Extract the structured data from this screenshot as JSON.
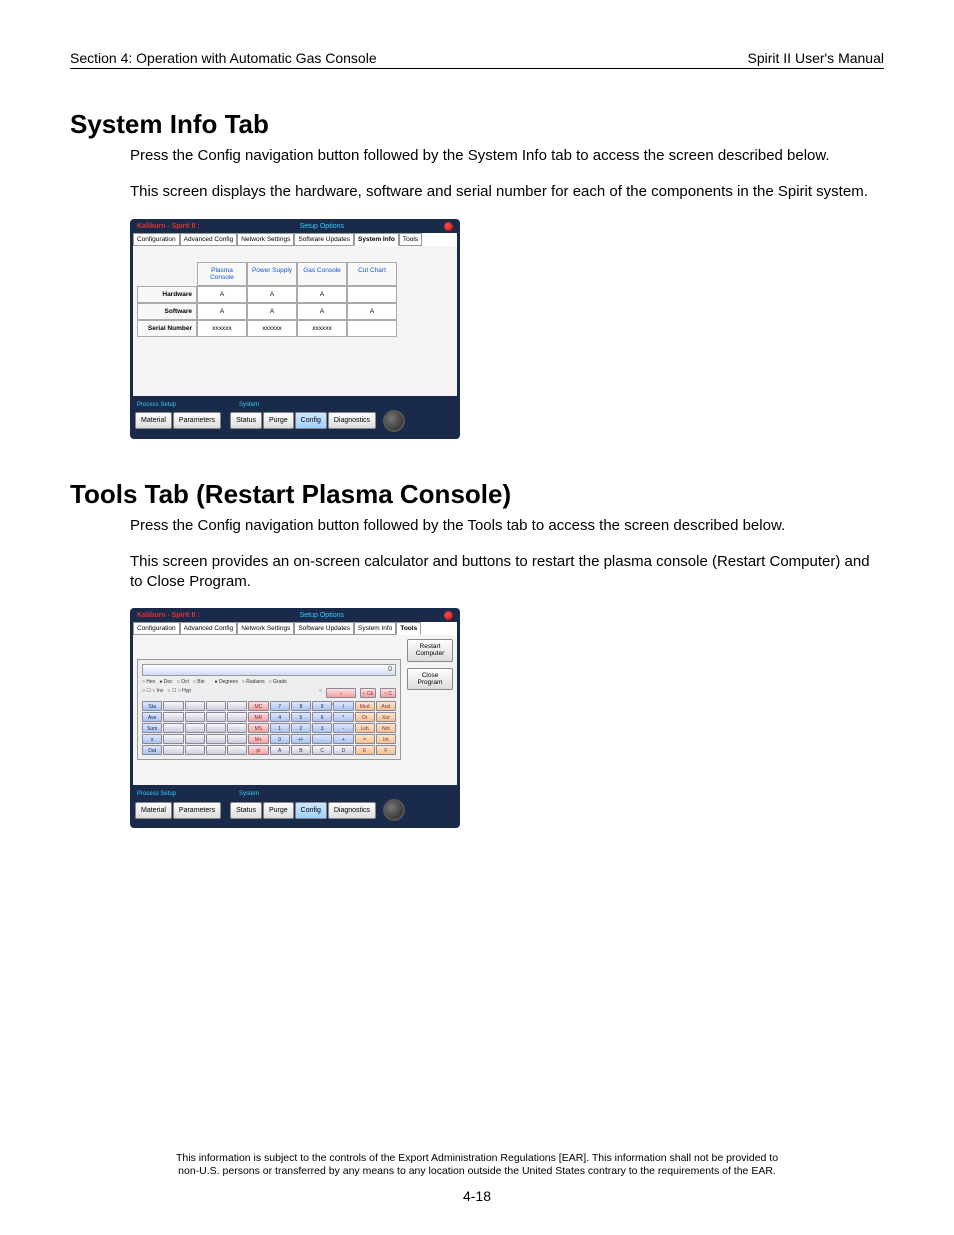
{
  "header": {
    "left": "Section 4: Operation with Automatic Gas Console",
    "right": "Spirit II User's Manual"
  },
  "section1": {
    "title": "System Info Tab",
    "p1": "Press the Config navigation button followed by the System Info tab to access the screen described below.",
    "p2": "This screen displays the hardware, software and serial number for each of the components in the Spirit system."
  },
  "section2": {
    "title": "Tools Tab (Restart Plasma Console)",
    "p1": "Press the Config navigation button followed by the Tools tab to access the screen described below.",
    "p2": "This screen provides an on-screen calculator and buttons to restart the plasma console (Restart Computer) and to Close Program."
  },
  "app": {
    "title_left": "Kaliburn - Spirit II :",
    "title_mid": "Setup Options",
    "tabs": [
      "Configuration",
      "Advanced Config",
      "Network Settings",
      "Software Updates",
      "System Info",
      "Tools"
    ],
    "bottom": {
      "group_left": "Process Setup",
      "group_right": "System",
      "buttons": [
        "Material",
        "Parameters",
        "Status",
        "Purge",
        "Config",
        "Diagnostics"
      ]
    }
  },
  "sysinfo": {
    "cols": [
      "Plasma Console",
      "Power Supply",
      "Gas Console",
      "Cut Chart"
    ],
    "rows": [
      "Hardware",
      "Software",
      "Serial Number"
    ],
    "cells": [
      [
        "A",
        "A",
        "A",
        ""
      ],
      [
        "A",
        "A",
        "A",
        "A"
      ],
      [
        "xxxxxx",
        "xxxxxx",
        "xxxxxx",
        ""
      ]
    ]
  },
  "tools": {
    "restart": "Restart Computer",
    "close": "Close Program",
    "disp": "0",
    "radios_top": [
      "Hex",
      "Dec",
      "Oct",
      "Bin",
      "Degrees",
      "Radians",
      "Grads"
    ],
    "radios_sel": "Dec",
    "fn_cols": [
      "Inv",
      "Hyp"
    ],
    "key_rows": [
      [
        "Sta",
        "",
        "",
        "",
        "",
        "MC",
        "7",
        "8",
        "9",
        "/",
        "Mod",
        "And"
      ],
      [
        "Ave",
        "",
        "",
        "",
        "",
        "MR",
        "4",
        "5",
        "6",
        "*",
        "Or",
        "Xor"
      ],
      [
        "Sum",
        "",
        "",
        "",
        "",
        "MS",
        "1",
        "2",
        "3",
        "-",
        "Lsh",
        "Not"
      ],
      [
        "s",
        "",
        "",
        "",
        "",
        "M+",
        "0",
        "+/-",
        ".",
        "+",
        "=",
        "Int"
      ],
      [
        "Dat",
        "",
        "",
        "",
        "",
        "pi",
        "A",
        "B",
        "C",
        "D",
        "E",
        "F"
      ]
    ],
    "top_fn": [
      "Backspace",
      "CE",
      "C"
    ]
  },
  "footer": {
    "line1": "This information is subject to the controls of the Export Administration Regulations [EAR].  This information shall not be provided to",
    "line2": "non-U.S. persons or transferred by any means to any location outside the United States contrary to the requirements of the EAR.",
    "page": "4-18"
  }
}
